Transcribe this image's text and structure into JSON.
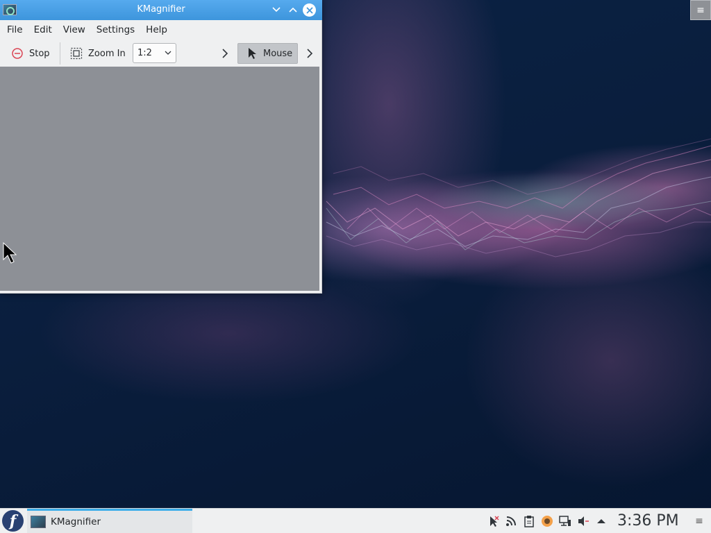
{
  "window": {
    "title": "KMagnifier",
    "menu": [
      "File",
      "Edit",
      "View",
      "Settings",
      "Help"
    ],
    "toolbar": {
      "stop_label": "Stop",
      "zoom_in_label": "Zoom In",
      "zoom_value": "1:2",
      "mouse_label": "Mouse"
    }
  },
  "taskbar": {
    "task_label": "KMagnifier",
    "clock": "3:36 PM"
  },
  "colors": {
    "titlebar": "#3d95dc",
    "stop_icon": "#da4453",
    "magnifier_view": "#8d9096"
  },
  "icons": {
    "window": "kmagnifier-app-icon",
    "stop": "stop-icon",
    "zoom_in": "zoom-in-icon",
    "mouse": "mouse-cursor-icon"
  }
}
